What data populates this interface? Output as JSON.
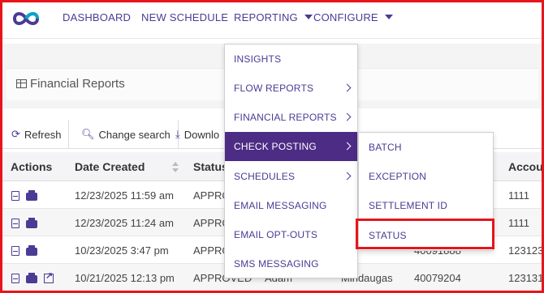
{
  "nav": {
    "items": [
      "DASHBOARD",
      "NEW SCHEDULE",
      "REPORTING",
      "CONFIGURE"
    ]
  },
  "page": {
    "title": "Financial Reports"
  },
  "toolbar": {
    "refresh": "Refresh",
    "change_search": "Change search",
    "download": "Downlo"
  },
  "table": {
    "headers": [
      "Actions",
      "Date Created",
      "Status",
      "Accou"
    ],
    "rows": [
      {
        "date": "12/23/2025 11:59 am",
        "status": "APPRO",
        "num": "",
        "acct": "1111"
      },
      {
        "date": "12/23/2025 11:24 am",
        "status": "APPRO",
        "num": "",
        "acct": "1111"
      },
      {
        "date": "10/23/2025 3:47 pm",
        "status": "APPRO",
        "num": "40091888",
        "acct": "123123"
      },
      {
        "date": "10/21/2025 12:13 pm",
        "status": "APPROVED",
        "first": "Adam",
        "last": "Mindaugas",
        "num": "40079204",
        "acct": "123131"
      }
    ]
  },
  "reporting_menu": [
    "INSIGHTS",
    "FLOW REPORTS",
    "FINANCIAL REPORTS",
    "CHECK POSTING",
    "SCHEDULES",
    "EMAIL MESSAGING",
    "EMAIL OPT-OUTS",
    "SMS MESSAGING"
  ],
  "check_posting_submenu": [
    "BATCH",
    "EXCEPTION",
    "SETTLEMENT ID",
    "STATUS"
  ],
  "colors": {
    "brand": "#4b3b94",
    "active_menu": "#4c2c84",
    "highlight": "#e8141b"
  }
}
